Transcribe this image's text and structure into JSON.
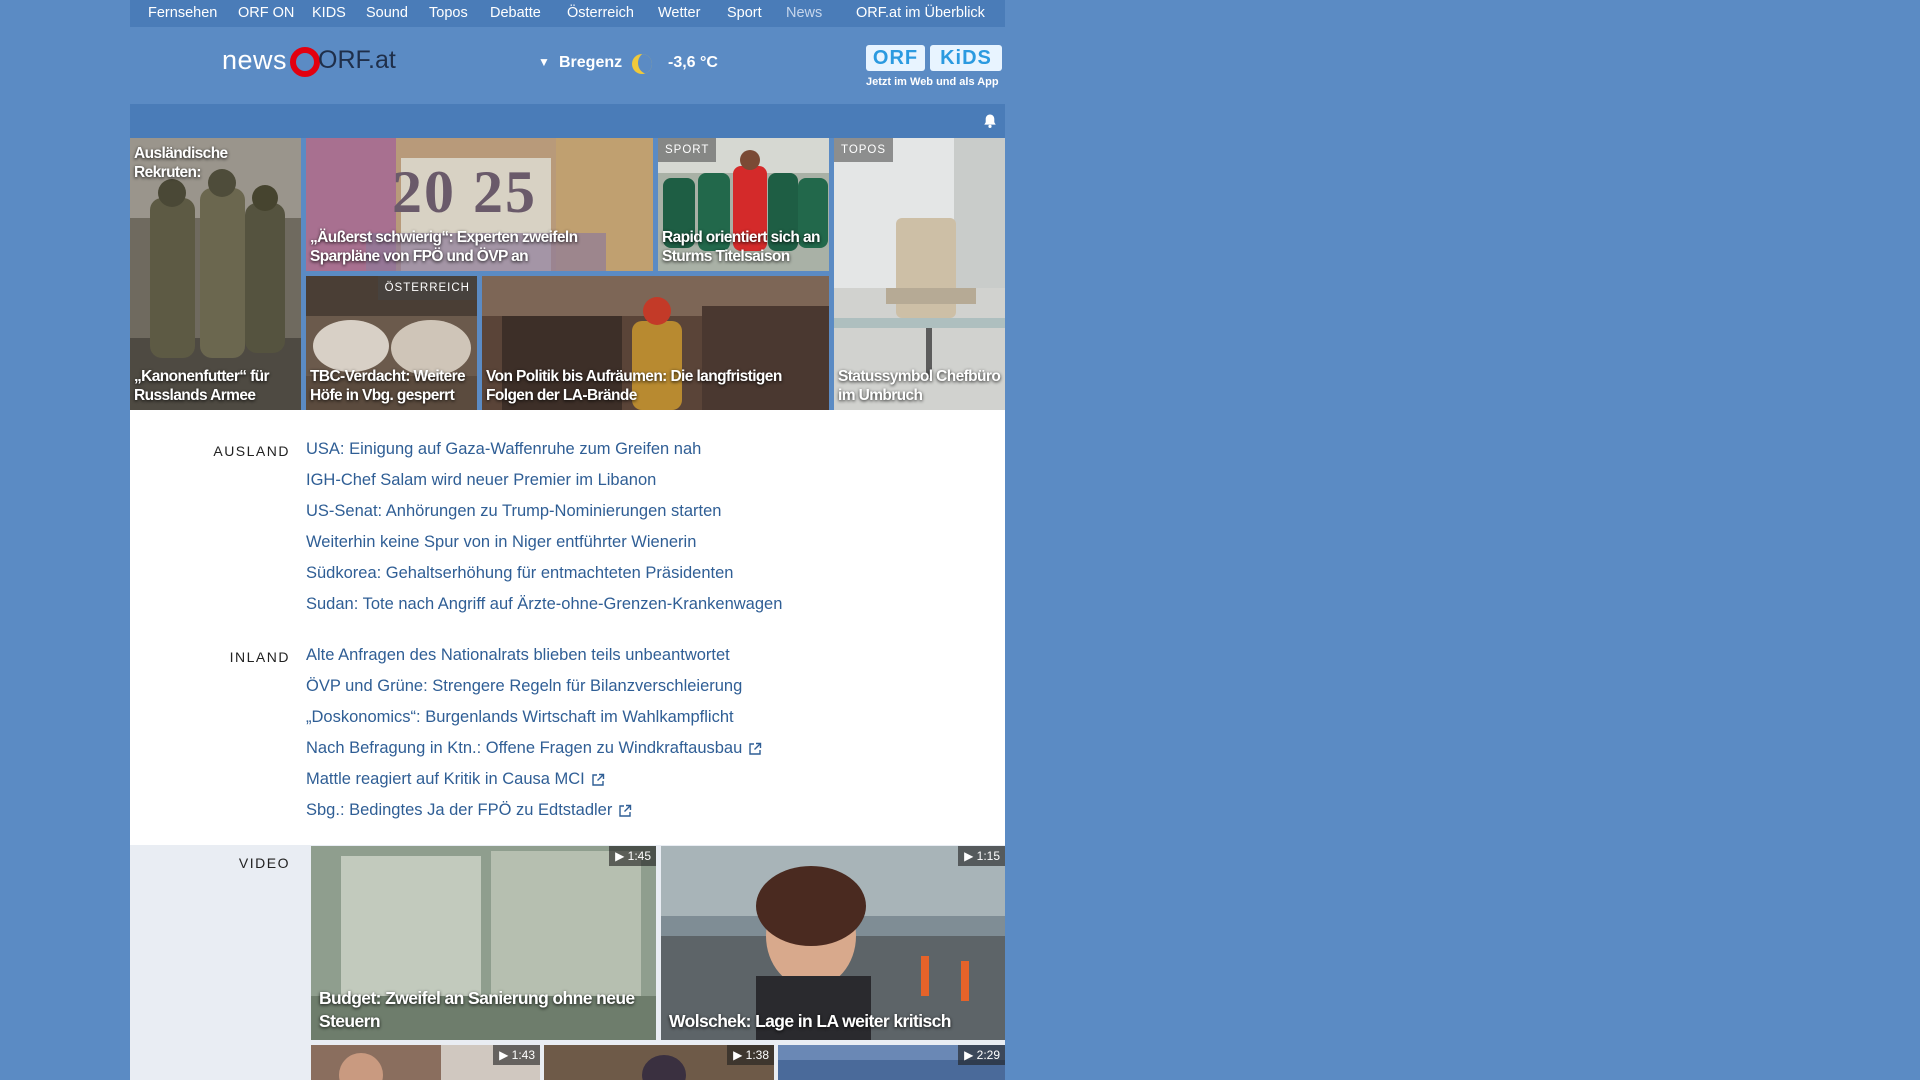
{
  "topnav": {
    "items": [
      "Fernsehen",
      "ORF ON",
      "KIDS",
      "Sound",
      "Topos",
      "Debatte",
      "Österreich",
      "Wetter",
      "Sport",
      "News"
    ],
    "overview": "ORF.at im Überblick"
  },
  "header": {
    "logo_news": "news",
    "logo_orf": "ORF.at",
    "weather": {
      "city": "Bregenz",
      "temperature": "-3,6 °C",
      "icon": "moon-icon"
    },
    "kids_banner": {
      "orf": "ORF",
      "kids": "KiDS",
      "tagline": "Jetzt im Web und als App"
    }
  },
  "teasers": [
    {
      "caption_top": "Ausländische Rekruten:",
      "caption": "„Kanonenfutter“ für Russlands Armee",
      "label": ""
    },
    {
      "caption": "„Äußerst schwierig“: Experten zweifeln Sparpläne von FPÖ und ÖVP an",
      "label": ""
    },
    {
      "caption": "Rapid orientiert sich an Sturms Titelsaison",
      "label": "SPORT"
    },
    {
      "caption": "Statussymbol Chefbüro im Umbruch",
      "label": "TOPOS"
    },
    {
      "caption": "TBC-Verdacht: Weitere Höfe in Vbg. gesperrt",
      "label": "ÖSTERREICH"
    },
    {
      "caption": "Von Politik bis Aufräumen: Die langfristigen Folgen der LA-Brände",
      "label": ""
    }
  ],
  "teaser_image_text": "20 25",
  "sections": {
    "ausland": {
      "title": "AUSLAND",
      "links": [
        "USA: Einigung auf Gaza-Waffenruhe zum Greifen nah",
        "IGH-Chef Salam wird neuer Premier im Libanon",
        "US-Senat: Anhörungen zu Trump-Nominierungen starten",
        "Weiterhin keine Spur von in Niger entführter Wienerin",
        "Südkorea: Gehaltserhöhung für entmachteten Präsidenten",
        "Sudan: Tote nach Angriff auf Ärzte-ohne-Grenzen-Krankenwagen"
      ]
    },
    "inland": {
      "title": "INLAND",
      "links": [
        "Alte Anfragen des Nationalrats blieben teils unbeantwortet",
        "ÖVP und Grüne: Strengere Regeln für Bilanzverschleierung",
        "„Doskonomics“: Burgenlands Wirtschaft im Wahlkampflicht",
        "Nach Befragung in Ktn.: Offene Fragen zu Windkraftausbau",
        "Mattle reagiert auf Kritik in Causa MCI",
        "Sbg.: Bedingtes Ja der FPÖ zu Edtstadler"
      ]
    }
  },
  "video": {
    "title": "VIDEO",
    "items": [
      {
        "caption": "Budget: Zweifel an Sanierung ohne neue Steuern",
        "duration": "1:45"
      },
      {
        "caption": "Wolschek: Lage in LA weiter kritisch",
        "duration": "1:15"
      },
      {
        "caption": "",
        "duration": "1:43"
      },
      {
        "caption": "",
        "duration": "1:38"
      },
      {
        "caption": "",
        "duration": "2:29"
      }
    ]
  },
  "colors": {
    "page_background": "#5b8bc4",
    "nav_bar": "#4a7cb8",
    "link": "#2f5e95",
    "orf_red": "#e3000f"
  }
}
